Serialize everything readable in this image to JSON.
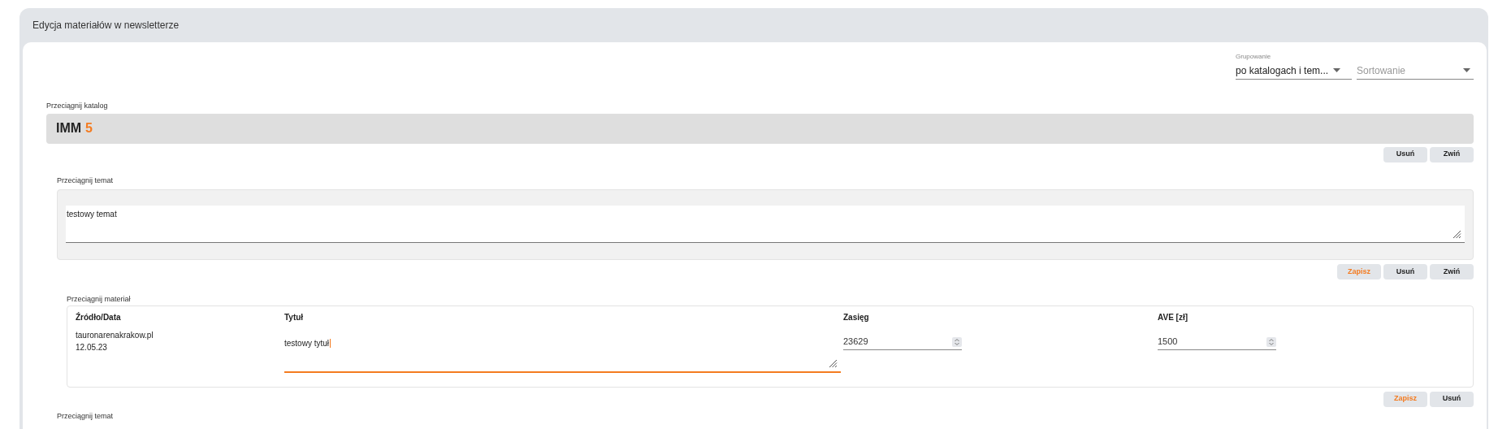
{
  "panel": {
    "title": "Edycja materiałów w newsletterze"
  },
  "grouping": {
    "label": "Grupowanie",
    "value": "po katalogach i tem..."
  },
  "sorting": {
    "placeholder": "Sortowanie"
  },
  "catalog": {
    "drag_label": "Przeciągnij katalog",
    "name": "IMM",
    "count": "5",
    "buttons": [
      {
        "label": "Usuń",
        "kind": "plain"
      },
      {
        "label": "Zwiń",
        "kind": "plain"
      }
    ]
  },
  "topic": {
    "drag_label": "Przeciągnij temat",
    "value": "testowy temat",
    "buttons": [
      {
        "label": "Zapisz",
        "kind": "accent"
      },
      {
        "label": "Usuń",
        "kind": "plain"
      },
      {
        "label": "Zwiń",
        "kind": "plain"
      }
    ]
  },
  "material": {
    "drag_label": "Przeciągnij materiał",
    "columns": [
      "Źródło/Data",
      "Tytuł",
      "Zasięg",
      "AVE [zł]"
    ],
    "source": "tauronarenakrakow.pl",
    "date": "12.05.23",
    "title": "testowy tytuł",
    "title_focused": true,
    "reach": "23629",
    "ave": "1500",
    "buttons": [
      {
        "label": "Zapisz",
        "kind": "accent"
      },
      {
        "label": "Usuń",
        "kind": "plain"
      }
    ]
  },
  "next_topic": {
    "drag_label": "Przeciągnij temat"
  }
}
